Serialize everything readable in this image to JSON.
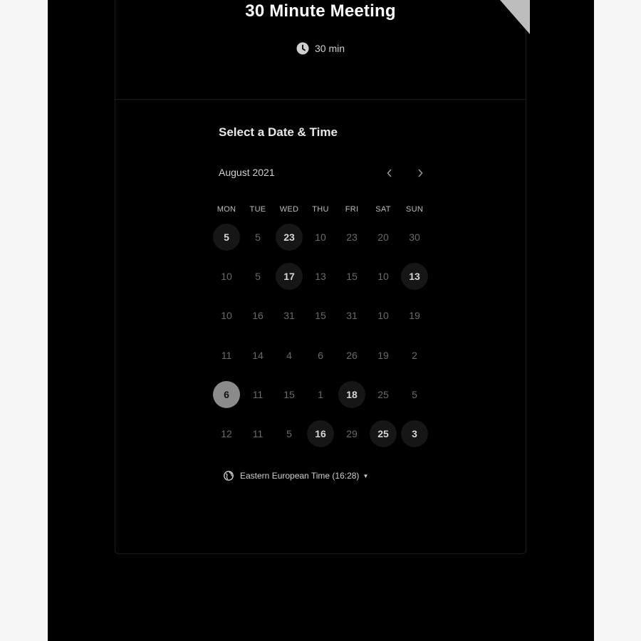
{
  "event": {
    "title": "30 Minute Meeting",
    "duration": "30 min"
  },
  "calendar": {
    "section_title": "Select a Date & Time",
    "month_label": "August 2021",
    "prev_icon": "chevron-left-icon",
    "next_icon": "chevron-right-icon",
    "weekdays": [
      "MON",
      "TUE",
      "WED",
      "THU",
      "FRI",
      "SAT",
      "SUN"
    ],
    "weeks": [
      [
        {
          "d": "5",
          "s": "avail"
        },
        {
          "d": "5",
          "s": "off"
        },
        {
          "d": "23",
          "s": "avail"
        },
        {
          "d": "10",
          "s": "off"
        },
        {
          "d": "23",
          "s": "off"
        },
        {
          "d": "20",
          "s": "off"
        },
        {
          "d": "30",
          "s": "off"
        }
      ],
      [
        {
          "d": "10",
          "s": "off"
        },
        {
          "d": "5",
          "s": "off"
        },
        {
          "d": "17",
          "s": "avail"
        },
        {
          "d": "13",
          "s": "off"
        },
        {
          "d": "15",
          "s": "off"
        },
        {
          "d": "10",
          "s": "off"
        },
        {
          "d": "13",
          "s": "avail"
        }
      ],
      [
        {
          "d": "10",
          "s": "off"
        },
        {
          "d": "16",
          "s": "off"
        },
        {
          "d": "31",
          "s": "off"
        },
        {
          "d": "15",
          "s": "off"
        },
        {
          "d": "31",
          "s": "off"
        },
        {
          "d": "10",
          "s": "off"
        },
        {
          "d": "19",
          "s": "off"
        }
      ],
      [
        {
          "d": "11",
          "s": "off"
        },
        {
          "d": "14",
          "s": "off"
        },
        {
          "d": "4",
          "s": "off"
        },
        {
          "d": "6",
          "s": "off"
        },
        {
          "d": "26",
          "s": "off"
        },
        {
          "d": "19",
          "s": "off"
        },
        {
          "d": "2",
          "s": "off"
        }
      ],
      [
        {
          "d": "6",
          "s": "selected"
        },
        {
          "d": "11",
          "s": "off"
        },
        {
          "d": "15",
          "s": "off"
        },
        {
          "d": "1",
          "s": "off"
        },
        {
          "d": "18",
          "s": "avail"
        },
        {
          "d": "25",
          "s": "off"
        },
        {
          "d": "5",
          "s": "off"
        }
      ],
      [
        {
          "d": "12",
          "s": "off"
        },
        {
          "d": "11",
          "s": "off"
        },
        {
          "d": "5",
          "s": "off"
        },
        {
          "d": "16",
          "s": "avail"
        },
        {
          "d": "29",
          "s": "off"
        },
        {
          "d": "25",
          "s": "avail"
        },
        {
          "d": "3",
          "s": "avail"
        }
      ]
    ]
  },
  "timezone": {
    "label": "Eastern European Time (16:28)",
    "icon": "globe-icon"
  },
  "colors": {
    "background": "#000000",
    "selected": "#8b8b8b",
    "available": "#161616"
  }
}
